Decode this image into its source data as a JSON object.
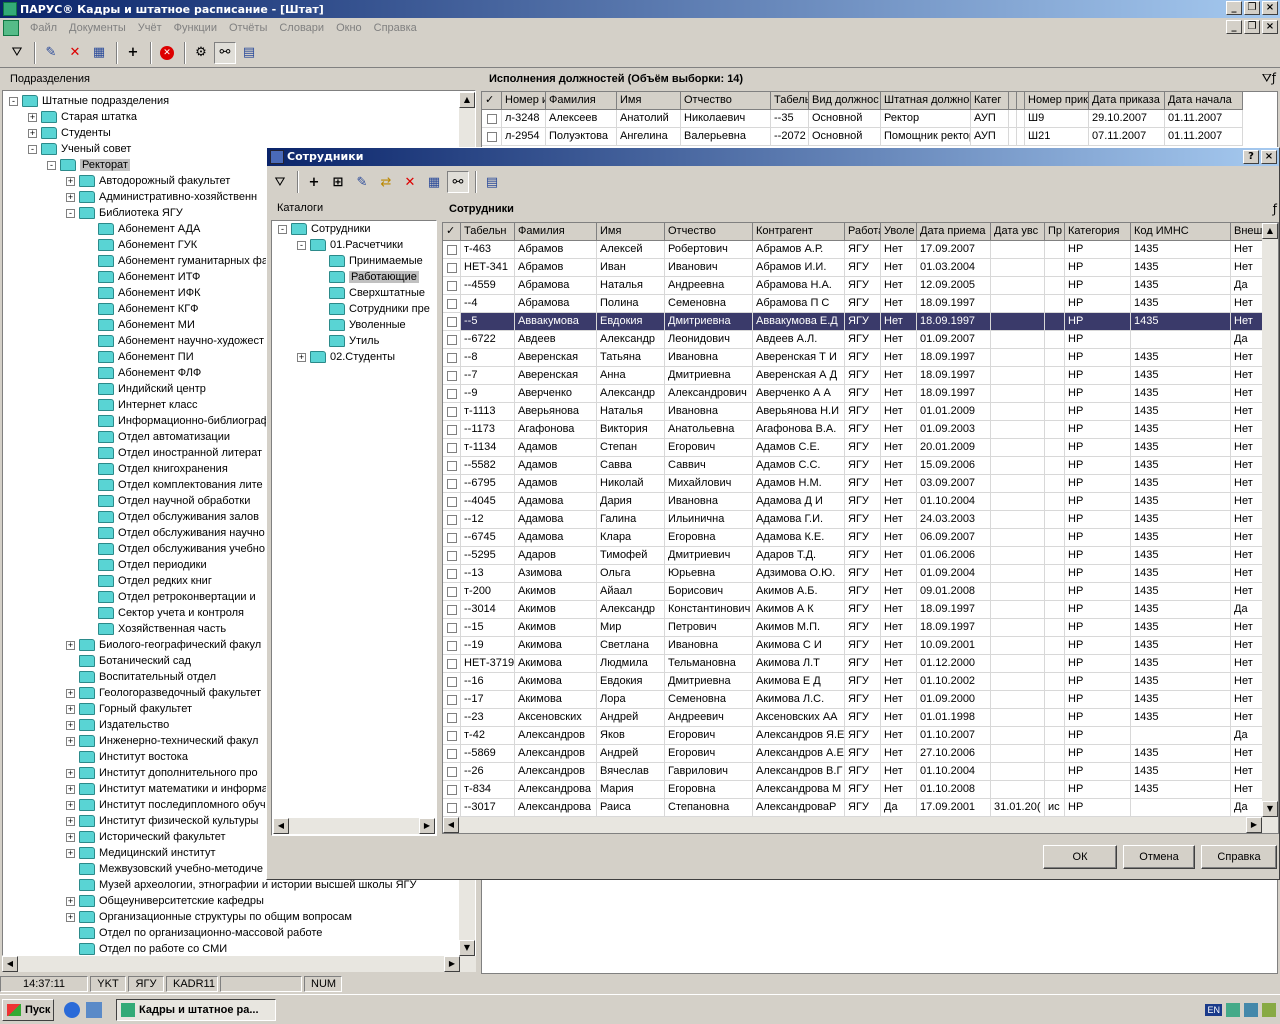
{
  "app": {
    "title": "ПАРУС® Кадры и штатное расписание - [Штат]",
    "menu": [
      "Файл",
      "Документы",
      "Учёт",
      "Функции",
      "Отчёты",
      "Словари",
      "Окно",
      "Справка"
    ]
  },
  "left_panel": {
    "header": "Подразделения",
    "tree": [
      {
        "label": "Штатные подразделения",
        "level": 0,
        "expander": "-"
      },
      {
        "label": "Старая штатка",
        "level": 1,
        "expander": "+"
      },
      {
        "label": "Студенты",
        "level": 1,
        "expander": "+"
      },
      {
        "label": "Ученый совет",
        "level": 1,
        "expander": "-"
      },
      {
        "label": "Ректорат",
        "level": 2,
        "expander": "-",
        "selected": true
      },
      {
        "label": "Автодорожный факультет",
        "level": 3,
        "expander": "+"
      },
      {
        "label": "Административно-хозяйственн",
        "level": 3,
        "expander": "+"
      },
      {
        "label": "Библиотека ЯГУ",
        "level": 3,
        "expander": "-"
      },
      {
        "label": "Абонемент АДА",
        "level": 4,
        "expander": ""
      },
      {
        "label": "Абонемент ГУК",
        "level": 4,
        "expander": ""
      },
      {
        "label": "Абонемент гуманитарных фа",
        "level": 4,
        "expander": ""
      },
      {
        "label": "Абонемент ИТФ",
        "level": 4,
        "expander": ""
      },
      {
        "label": "Абонемент ИФК",
        "level": 4,
        "expander": ""
      },
      {
        "label": "Абонемент КГФ",
        "level": 4,
        "expander": ""
      },
      {
        "label": "Абонемент МИ",
        "level": 4,
        "expander": ""
      },
      {
        "label": "Абонемент научно-художест",
        "level": 4,
        "expander": ""
      },
      {
        "label": "Абонемент ПИ",
        "level": 4,
        "expander": ""
      },
      {
        "label": "Абонемент ФЛФ",
        "level": 4,
        "expander": ""
      },
      {
        "label": "Индийский центр",
        "level": 4,
        "expander": ""
      },
      {
        "label": "Интернет класс",
        "level": 4,
        "expander": ""
      },
      {
        "label": "Информационно-библиограф",
        "level": 4,
        "expander": ""
      },
      {
        "label": "Отдел автоматизации",
        "level": 4,
        "expander": ""
      },
      {
        "label": "Отдел иностранной литерат",
        "level": 4,
        "expander": ""
      },
      {
        "label": "Отдел книгохранения",
        "level": 4,
        "expander": ""
      },
      {
        "label": "Отдел комплектования лите",
        "level": 4,
        "expander": ""
      },
      {
        "label": "Отдел научной обработки",
        "level": 4,
        "expander": ""
      },
      {
        "label": "Отдел обслуживания залов",
        "level": 4,
        "expander": ""
      },
      {
        "label": "Отдел обслуживания научно",
        "level": 4,
        "expander": ""
      },
      {
        "label": "Отдел обслуживания учебно",
        "level": 4,
        "expander": ""
      },
      {
        "label": "Отдел периодики",
        "level": 4,
        "expander": ""
      },
      {
        "label": "Отдел редких книг",
        "level": 4,
        "expander": ""
      },
      {
        "label": "Отдел ретроконвертации и",
        "level": 4,
        "expander": ""
      },
      {
        "label": "Сектор учета и контроля",
        "level": 4,
        "expander": ""
      },
      {
        "label": "Хозяйственная часть",
        "level": 4,
        "expander": ""
      },
      {
        "label": "Биолого-географический факул",
        "level": 3,
        "expander": "+"
      },
      {
        "label": "Ботанический сад",
        "level": 3,
        "expander": ""
      },
      {
        "label": "Воспитательный отдел",
        "level": 3,
        "expander": ""
      },
      {
        "label": "Геологоразведочный факультет",
        "level": 3,
        "expander": "+"
      },
      {
        "label": "Горный факультет",
        "level": 3,
        "expander": "+"
      },
      {
        "label": "Издательство",
        "level": 3,
        "expander": "+"
      },
      {
        "label": "Инженерно-технический факул",
        "level": 3,
        "expander": "+"
      },
      {
        "label": "Институт востока",
        "level": 3,
        "expander": ""
      },
      {
        "label": "Институт дополнительного про",
        "level": 3,
        "expander": "+"
      },
      {
        "label": "Институт математики и информа",
        "level": 3,
        "expander": "+"
      },
      {
        "label": "Институт последипломного обуч",
        "level": 3,
        "expander": "+"
      },
      {
        "label": "Институт физической культуры",
        "level": 3,
        "expander": "+"
      },
      {
        "label": "Исторический факультет",
        "level": 3,
        "expander": "+"
      },
      {
        "label": "Медицинский институт",
        "level": 3,
        "expander": "+"
      },
      {
        "label": "Межвузовский учебно-методиче",
        "level": 3,
        "expander": ""
      },
      {
        "label": "Музей археологии, этнографии и истории высшей школы ЯГУ",
        "level": 3,
        "expander": ""
      },
      {
        "label": "Общеуниверситетские кафедры",
        "level": 3,
        "expander": "+"
      },
      {
        "label": "Организационные структуры по общим вопросам",
        "level": 3,
        "expander": "+"
      },
      {
        "label": "Отдел по организационно-массовой работе",
        "level": 3,
        "expander": ""
      },
      {
        "label": "Отдел по работе со СМИ",
        "level": 3,
        "expander": ""
      }
    ]
  },
  "right_panel": {
    "header": "Исполнения должностей (Объём выборки: 14)",
    "columns": [
      "✓",
      "Номер и",
      "Фамилия",
      "Имя",
      "Отчество",
      "Табель",
      "Вид должнос",
      "Штатная должность",
      "Катег",
      "",
      "",
      "Номер прик",
      "Дата приказа",
      "Дата начала"
    ],
    "rows": [
      [
        "",
        "л-3248",
        "Алексеев",
        "Анатолий",
        "Николаевич",
        "--35",
        "Основной",
        "Ректор",
        "АУП",
        "",
        "",
        "Ш9",
        "29.10.2007",
        "01.11.2007"
      ],
      [
        "",
        "л-2954",
        "Полуэктова",
        "Ангелина",
        "Валерьевна",
        "--2072",
        "Основной",
        "Помощник ректора",
        "АУП",
        "",
        "",
        "Ш21",
        "07.11.2007",
        "01.11.2007"
      ]
    ]
  },
  "dialog": {
    "title": "Сотрудники",
    "catalog_header": "Каталоги",
    "catalog_tree": [
      {
        "label": "Сотрудники",
        "level": 0,
        "expander": "-"
      },
      {
        "label": "01.Расчетчики",
        "level": 1,
        "expander": "-"
      },
      {
        "label": "Принимаемые",
        "level": 2,
        "expander": ""
      },
      {
        "label": "Работающие",
        "level": 2,
        "expander": "",
        "selected": true
      },
      {
        "label": "Сверхштатные",
        "level": 2,
        "expander": ""
      },
      {
        "label": "Сотрудники пре",
        "level": 2,
        "expander": ""
      },
      {
        "label": "Уволенные",
        "level": 2,
        "expander": ""
      },
      {
        "label": "Утиль",
        "level": 2,
        "expander": ""
      },
      {
        "label": "02.Студенты",
        "level": 1,
        "expander": "+"
      }
    ],
    "grid_header": "Сотрудники",
    "columns": [
      "✓",
      "Табельн",
      "Фамилия",
      "Имя",
      "Отчество",
      "Контрагент",
      "Работа",
      "Уволе",
      "Дата приема",
      "Дата увс",
      "Пр",
      "Категория",
      "Код ИМНС",
      "Внеш"
    ],
    "rows": [
      [
        "т-463",
        "Абрамов",
        "Алексей",
        "Робертович",
        "Абрамов А.Р.",
        "ЯГУ",
        "Нет",
        "17.09.2007",
        "",
        "",
        "НР",
        "1435",
        "Нет"
      ],
      [
        "НЕТ-341",
        "Абрамов",
        "Иван",
        "Иванович",
        "Абрамов И.И.",
        "ЯГУ",
        "Нет",
        "01.03.2004",
        "",
        "",
        "НР",
        "1435",
        "Нет"
      ],
      [
        "--4559",
        "Абрамова",
        "Наталья",
        "Андреевна",
        "Абрамова Н.А.",
        "ЯГУ",
        "Нет",
        "12.09.2005",
        "",
        "",
        "НР",
        "1435",
        "Да"
      ],
      [
        "--4",
        "Абрамова",
        "Полина",
        "Семеновна",
        "Абрамова П С",
        "ЯГУ",
        "Нет",
        "18.09.1997",
        "",
        "",
        "НР",
        "1435",
        "Нет"
      ],
      [
        "--5",
        "Аввакумова",
        "Евдокия",
        "Дмитриевна",
        "Аввакумова Е.Д",
        "ЯГУ",
        "Нет",
        "18.09.1997",
        "",
        "",
        "НР",
        "1435",
        "Нет"
      ],
      [
        "--6722",
        "Авдеев",
        "Александр",
        "Леонидович",
        "Авдеев А.Л.",
        "ЯГУ",
        "Нет",
        "01.09.2007",
        "",
        "",
        "НР",
        "",
        "Да"
      ],
      [
        "--8",
        "Аверенская",
        "Татьяна",
        "Ивановна",
        "Аверенская Т И",
        "ЯГУ",
        "Нет",
        "18.09.1997",
        "",
        "",
        "НР",
        "1435",
        "Нет"
      ],
      [
        "--7",
        "Аверенская",
        "Анна",
        "Дмитриевна",
        "Аверенская А Д",
        "ЯГУ",
        "Нет",
        "18.09.1997",
        "",
        "",
        "НР",
        "1435",
        "Нет"
      ],
      [
        "--9",
        "Аверченко",
        "Александр",
        "Александрович",
        "Аверченко А А",
        "ЯГУ",
        "Нет",
        "18.09.1997",
        "",
        "",
        "НР",
        "1435",
        "Нет"
      ],
      [
        "т-1113",
        "Аверьянова",
        "Наталья",
        "Ивановна",
        "Аверьянова Н.И",
        "ЯГУ",
        "Нет",
        "01.01.2009",
        "",
        "",
        "НР",
        "1435",
        "Нет"
      ],
      [
        "--1173",
        "Агафонова",
        "Виктория",
        "Анатольевна",
        "Агафонова В.А.",
        "ЯГУ",
        "Нет",
        "01.09.2003",
        "",
        "",
        "НР",
        "1435",
        "Нет"
      ],
      [
        "т-1134",
        "Адамов",
        "Степан",
        "Егорович",
        "Адамов С.Е.",
        "ЯГУ",
        "Нет",
        "20.01.2009",
        "",
        "",
        "НР",
        "1435",
        "Нет"
      ],
      [
        "--5582",
        "Адамов",
        "Савва",
        "Саввич",
        "Адамов С.С.",
        "ЯГУ",
        "Нет",
        "15.09.2006",
        "",
        "",
        "НР",
        "1435",
        "Нет"
      ],
      [
        "--6795",
        "Адамов",
        "Николай",
        "Михайлович",
        "Адамов Н.М.",
        "ЯГУ",
        "Нет",
        "03.09.2007",
        "",
        "",
        "НР",
        "1435",
        "Нет"
      ],
      [
        "--4045",
        "Адамова",
        "Дария",
        "Ивановна",
        "Адамова Д И",
        "ЯГУ",
        "Нет",
        "01.10.2004",
        "",
        "",
        "НР",
        "1435",
        "Нет"
      ],
      [
        "--12",
        "Адамова",
        "Галина",
        "Ильинична",
        "Адамова Г.И.",
        "ЯГУ",
        "Нет",
        "24.03.2003",
        "",
        "",
        "НР",
        "1435",
        "Нет"
      ],
      [
        "--6745",
        "Адамова",
        "Клара",
        "Егоровна",
        "Адамова К.Е.",
        "ЯГУ",
        "Нет",
        "06.09.2007",
        "",
        "",
        "НР",
        "1435",
        "Нет"
      ],
      [
        "--5295",
        "Адаров",
        "Тимофей",
        "Дмитриевич",
        "Адаров Т.Д.",
        "ЯГУ",
        "Нет",
        "01.06.2006",
        "",
        "",
        "НР",
        "1435",
        "Нет"
      ],
      [
        "--13",
        "Азимова",
        "Ольга",
        "Юрьевна",
        "Адзимова О.Ю.",
        "ЯГУ",
        "Нет",
        "01.09.2004",
        "",
        "",
        "НР",
        "1435",
        "Нет"
      ],
      [
        "т-200",
        "Акимов",
        "Айаал",
        "Борисович",
        "Акимов А.Б.",
        "ЯГУ",
        "Нет",
        "09.01.2008",
        "",
        "",
        "НР",
        "1435",
        "Нет"
      ],
      [
        "--3014",
        "Акимов",
        "Александр",
        "Константинович",
        "Акимов А К",
        "ЯГУ",
        "Нет",
        "18.09.1997",
        "",
        "",
        "НР",
        "1435",
        "Да"
      ],
      [
        "--15",
        "Акимов",
        "Мир",
        "Петрович",
        "Акимов М.П.",
        "ЯГУ",
        "Нет",
        "18.09.1997",
        "",
        "",
        "НР",
        "1435",
        "Нет"
      ],
      [
        "--19",
        "Акимова",
        "Светлана",
        "Ивановна",
        "Акимова С И",
        "ЯГУ",
        "Нет",
        "10.09.2001",
        "",
        "",
        "НР",
        "1435",
        "Нет"
      ],
      [
        "НЕТ-3719",
        "Акимова",
        "Людмила",
        "Тельмановна",
        "Акимова Л.Т",
        "ЯГУ",
        "Нет",
        "01.12.2000",
        "",
        "",
        "НР",
        "1435",
        "Нет"
      ],
      [
        "--16",
        "Акимова",
        "Евдокия",
        "Дмитриевна",
        "Акимова Е Д",
        "ЯГУ",
        "Нет",
        "01.10.2002",
        "",
        "",
        "НР",
        "1435",
        "Нет"
      ],
      [
        "--17",
        "Акимова",
        "Лора",
        "Семеновна",
        "Акимова Л.С.",
        "ЯГУ",
        "Нет",
        "01.09.2000",
        "",
        "",
        "НР",
        "1435",
        "Нет"
      ],
      [
        "--23",
        "Аксеновских",
        "Андрей",
        "Андреевич",
        "Аксеновских АА",
        "ЯГУ",
        "Нет",
        "01.01.1998",
        "",
        "",
        "НР",
        "1435",
        "Нет"
      ],
      [
        "т-42",
        "Александров",
        "Яков",
        "Егорович",
        "Александров Я.Е",
        "ЯГУ",
        "Нет",
        "01.10.2007",
        "",
        "",
        "НР",
        "",
        "Да"
      ],
      [
        "--5869",
        "Александров",
        "Андрей",
        "Егорович",
        "Александров А.Е",
        "ЯГУ",
        "Нет",
        "27.10.2006",
        "",
        "",
        "НР",
        "1435",
        "Нет"
      ],
      [
        "--26",
        "Александров",
        "Вячеслав",
        "Гаврилович",
        "Александров В.Г",
        "ЯГУ",
        "Нет",
        "01.10.2004",
        "",
        "",
        "НР",
        "1435",
        "Нет"
      ],
      [
        "т-834",
        "Александрова",
        "Мария",
        "Егоровна",
        "Александрова М",
        "ЯГУ",
        "Нет",
        "01.10.2008",
        "",
        "",
        "НР",
        "1435",
        "Нет"
      ],
      [
        "--3017",
        "Александрова",
        "Раиса",
        "Степановна",
        "АлександроваР",
        "ЯГУ",
        "Да",
        "17.09.2001",
        "31.01.20(",
        "ис",
        "НР",
        "",
        "Да"
      ]
    ],
    "selected_row": 4,
    "buttons": {
      "ok": "ОК",
      "cancel": "Отмена",
      "help": "Справка"
    }
  },
  "status": {
    "time": "14:37:11",
    "cells": [
      "YKT",
      "ЯГУ",
      "KADR11",
      "",
      "NUM"
    ]
  },
  "taskbar": {
    "start": "Пуск",
    "task": "Кадры и штатное ра...",
    "lang": "EN"
  }
}
